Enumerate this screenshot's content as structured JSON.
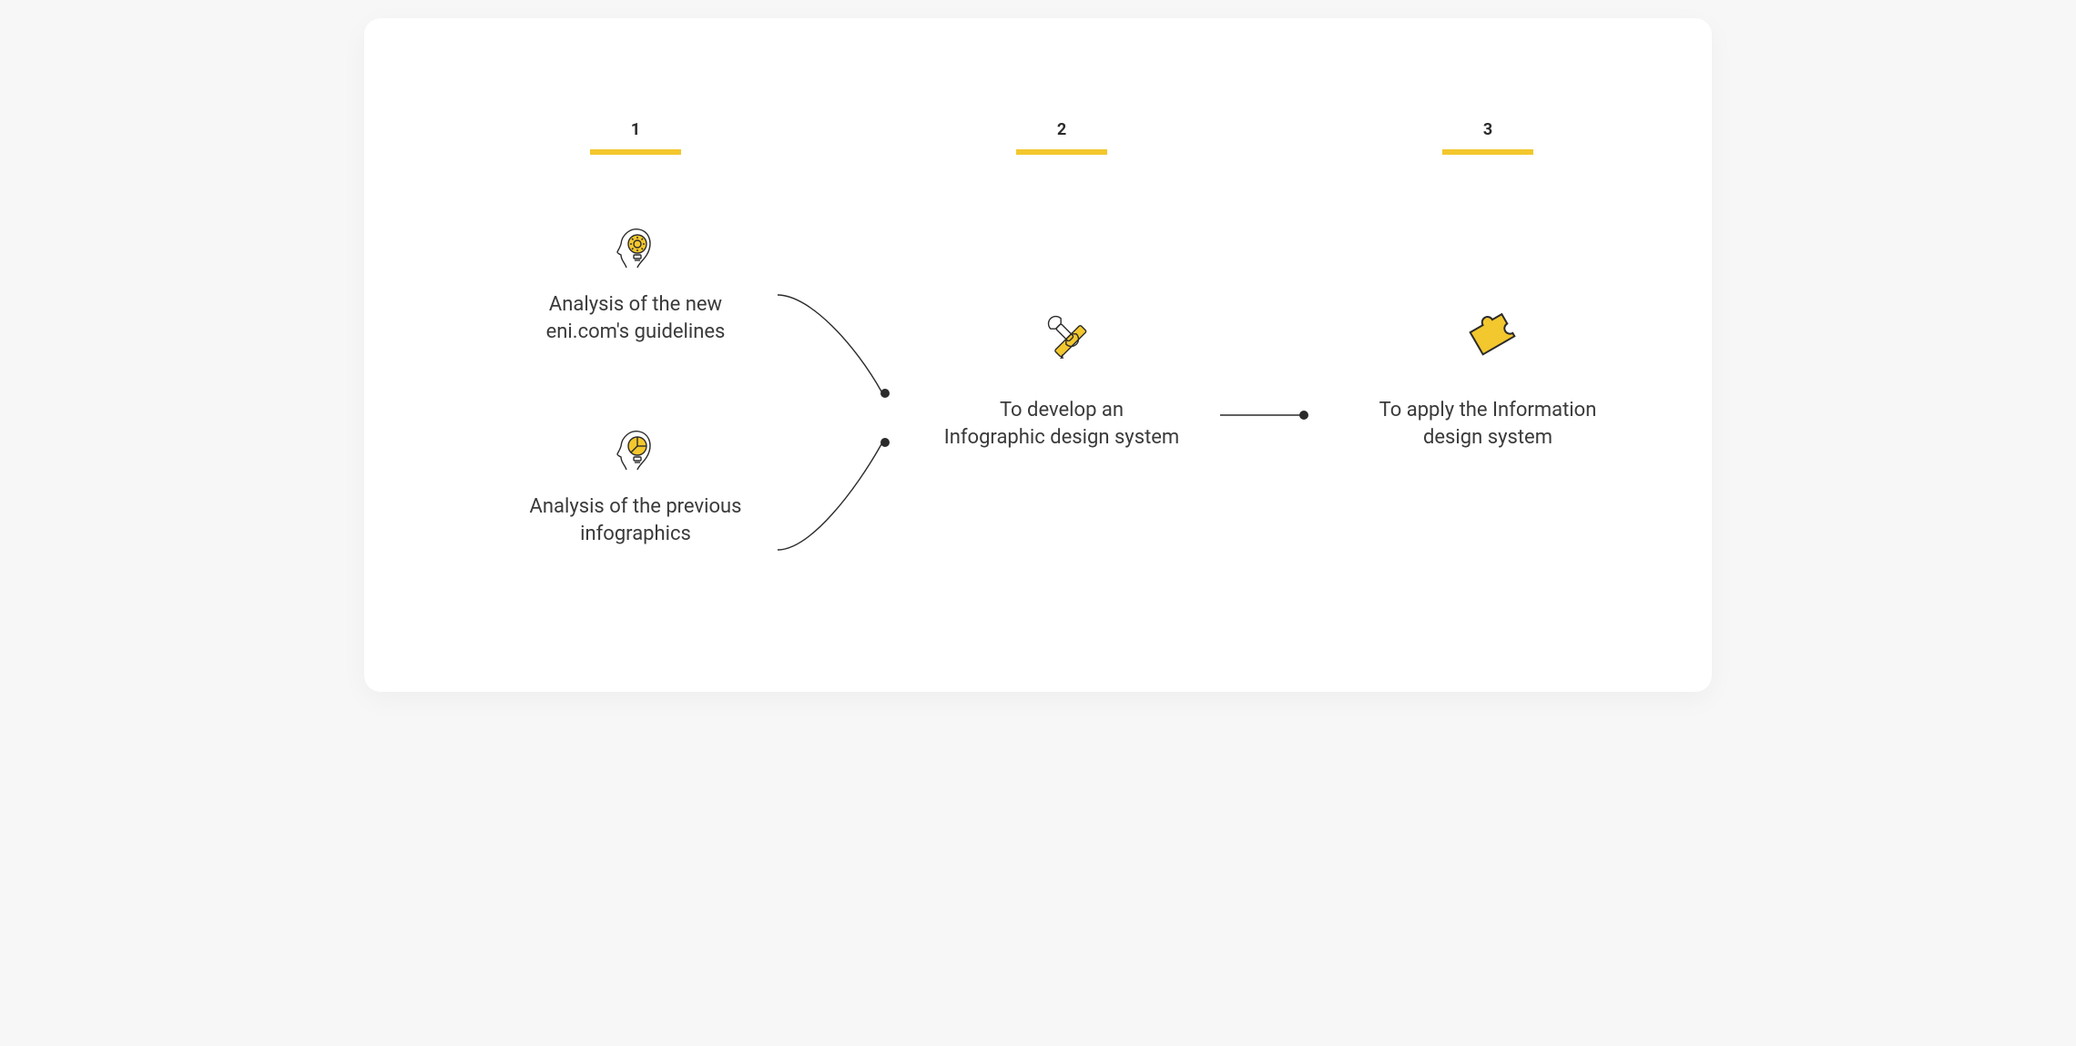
{
  "colors": {
    "accent": "#f3c72e",
    "text": "#3a3a3a",
    "numberText": "#2b2b2b",
    "background": "#ffffff",
    "pageBackground": "#f7f7f8"
  },
  "steps": [
    {
      "number": "1",
      "items": [
        {
          "icon": "head-gear-lightbulb",
          "caption_line1": "Analysis of the new",
          "caption_line2": "eni.com's guidelines"
        },
        {
          "icon": "head-chart-lightbulb",
          "caption_line1": "Analysis of the previous",
          "caption_line2": "infographics"
        }
      ]
    },
    {
      "number": "2",
      "items": [
        {
          "icon": "pencil-wrench-cross",
          "caption_line1": "To develop an",
          "caption_line2": "Infographic design system"
        }
      ]
    },
    {
      "number": "3",
      "items": [
        {
          "icon": "puzzle-piece",
          "caption_line1": "To apply the Information",
          "caption_line2": "design system"
        }
      ]
    }
  ]
}
